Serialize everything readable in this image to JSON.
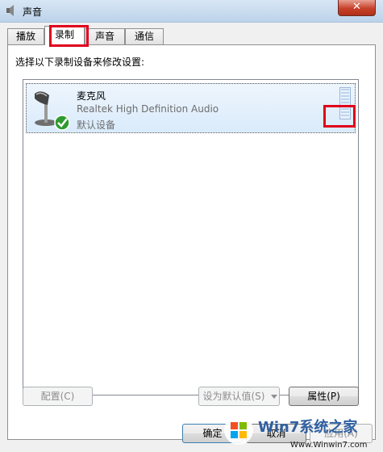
{
  "window": {
    "title": "声音"
  },
  "tabs": [
    {
      "label": "播放",
      "active": false
    },
    {
      "label": "录制",
      "active": true
    },
    {
      "label": "声音",
      "active": false
    },
    {
      "label": "通信",
      "active": false
    }
  ],
  "instruction": "选择以下录制设备来修改设置:",
  "devices": [
    {
      "name": "麦克风",
      "description": "Realtek High Definition Audio",
      "status": "默认设备",
      "icon": "microphone-icon",
      "default": true
    }
  ],
  "buttons": {
    "configure": "配置(C)",
    "set_default": "设为默认值(S)",
    "properties": "属性(P)",
    "ok": "确定",
    "cancel": "取消",
    "apply": "应用(A)"
  },
  "watermark": {
    "brand": "Win7系统之家",
    "url": "Www.Winwin7.com"
  },
  "colors": {
    "highlight": "#e0001b",
    "selection": "#d9ebfb",
    "check": "#2e9b2e"
  }
}
